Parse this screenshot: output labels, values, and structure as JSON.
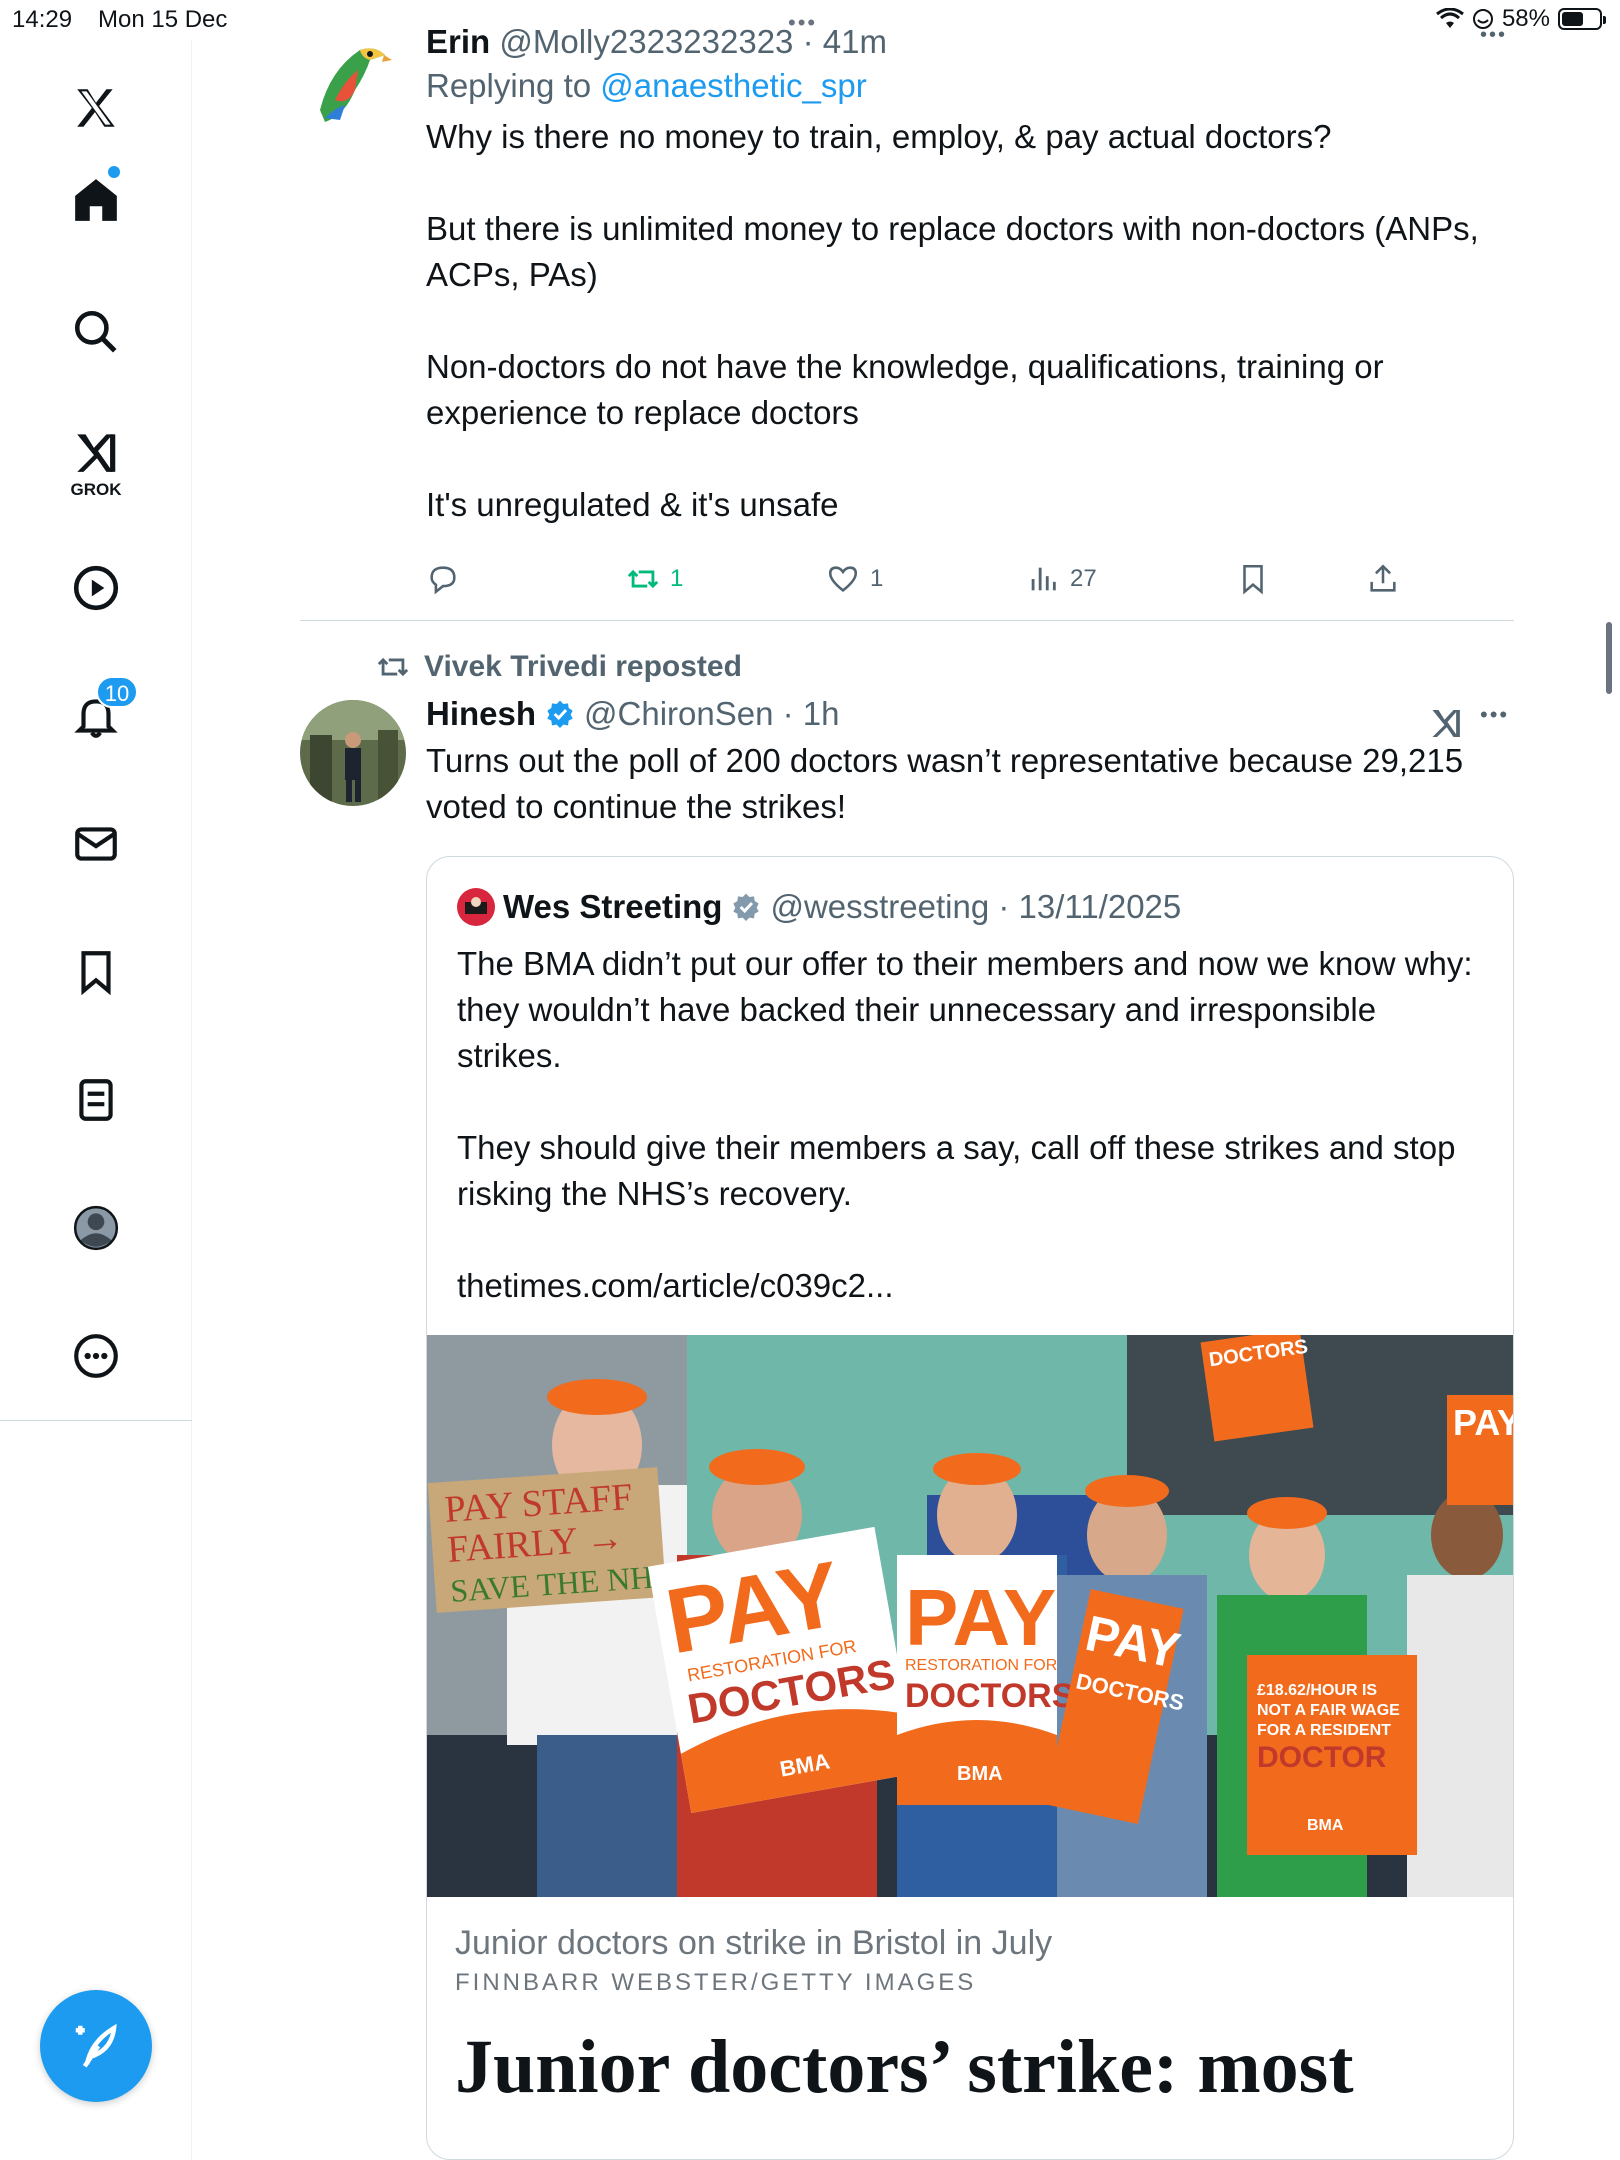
{
  "status_bar": {
    "time": "14:29",
    "date": "Mon 15 Dec",
    "battery": "58%",
    "battery_level": 0.58
  },
  "sidebar": {
    "grok_label": "GROK",
    "notifications_badge": "10",
    "icons": [
      "x-logo-icon",
      "home-icon",
      "search-icon",
      "grok-icon",
      "play-icon",
      "bell-icon",
      "mail-icon",
      "bookmark-icon",
      "lists-icon",
      "profile-icon",
      "more-icon",
      "compose-icon"
    ]
  },
  "reply_post": {
    "name": "Erin",
    "handle": "@Molly2323232323",
    "separator": " · ",
    "time": "41m",
    "replying_prefix": "Replying to ",
    "replying_to": "@anaesthetic_spr",
    "text": "Why is there no money to train, employ, & pay actual doctors?\n\nBut there is unlimited money to replace doctors with non-doctors (ANPs, ACPs, PAs)\n\nNon-doctors do not have the knowledge, qualifications, training or experience to replace doctors\n\nIt's unregulated & it's unsafe",
    "retweets": "1",
    "likes": "1",
    "views": "27"
  },
  "repost": {
    "reposted_by": "Vivek Trivedi reposted",
    "name": "Hinesh",
    "handle": "@ChironSen",
    "separator": " · ",
    "time": "1h",
    "text": "Turns out the poll of 200 doctors wasn’t representative because 29,215 voted to continue the strikes!",
    "quote": {
      "name": "Wes Streeting",
      "handle": "@wesstreeting",
      "separator": " · ",
      "date": "13/11/2025",
      "text": "The BMA didn’t put our offer to their members and now we know why: they wouldn’t have backed their unnecessary and irresponsible strikes.\n\nThey should give their members a say, call off these strikes and stop risking the NHS’s recovery.\n\nthetimes.com/article/c039c2...",
      "photo_signs": {
        "staff_sign_line1": "PAY STAFF",
        "staff_sign_line2": "FAIRLY →",
        "staff_sign_line3": "SAVE THE NHS",
        "pay": "PAY",
        "restoration": "RESTORATION FOR",
        "doctors": "DOCTORS",
        "bma": "BMA",
        "wage_line1": "£18.62/HOUR IS",
        "wage_line2": "NOT A FAIR WAGE",
        "wage_line3": "FOR A RESIDENT",
        "wage_line4": "DOCTOR"
      },
      "caption": "Junior doctors on strike in Bristol in July",
      "credit": "FINNBARR WEBSTER/GETTY IMAGES",
      "article_title": "Junior doctors’ strike: most"
    }
  }
}
